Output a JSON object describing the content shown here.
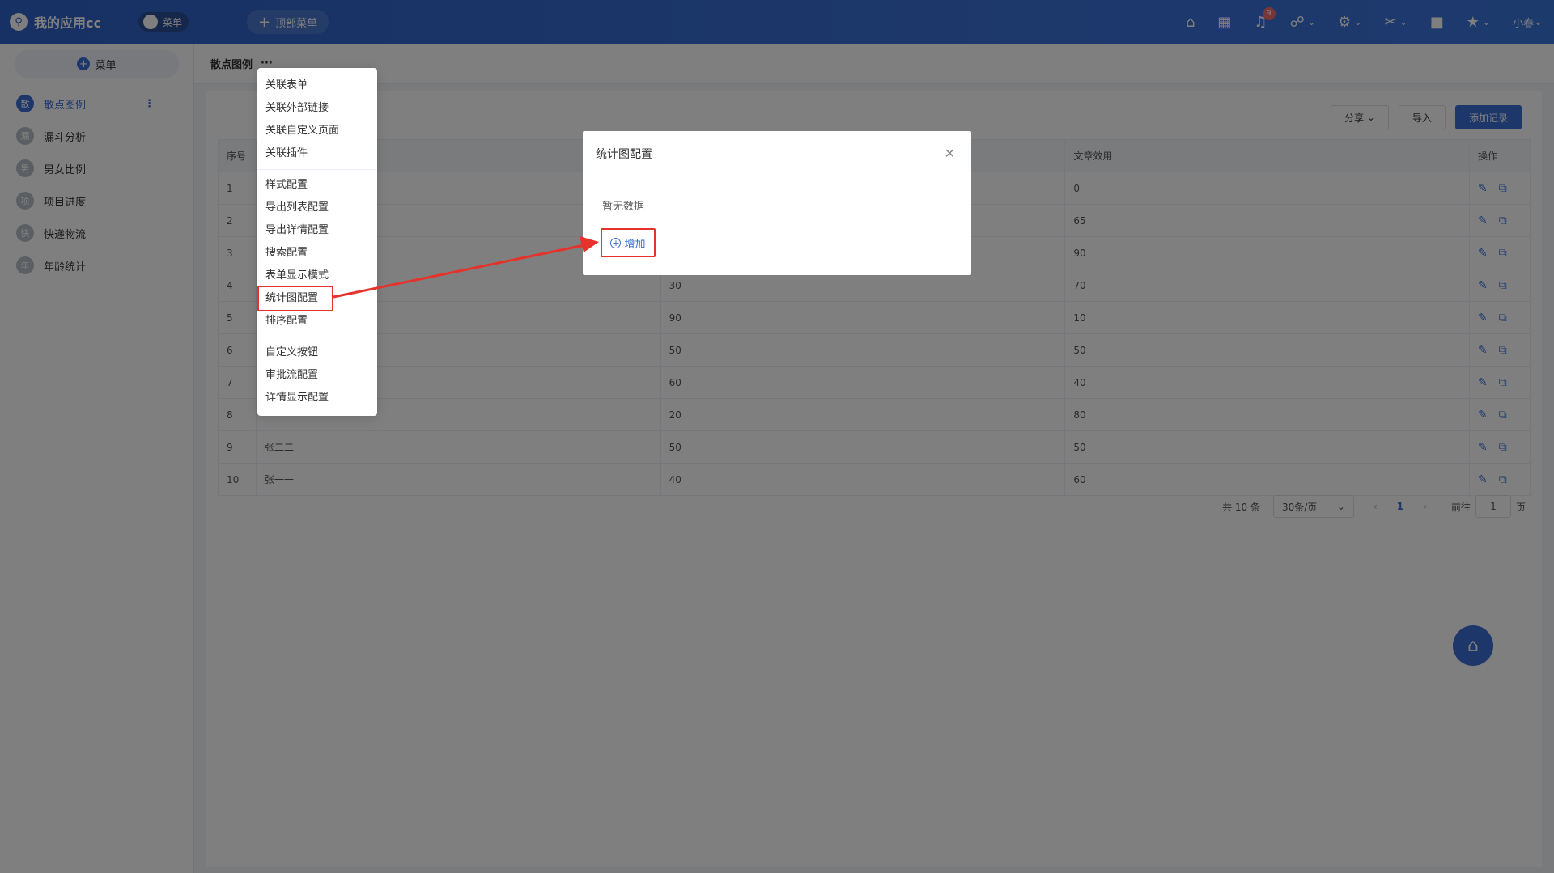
{
  "topbar": {
    "app_title": "我的应用cc",
    "menu_toggle_label": "菜单",
    "top_menu_label": "顶部菜单",
    "notification_count": "9",
    "user_name": "小春"
  },
  "sidebar": {
    "menu_button_label": "菜单",
    "items": [
      {
        "avatar": "散",
        "label": "散点图例"
      },
      {
        "avatar": "漏",
        "label": "漏斗分析"
      },
      {
        "avatar": "男",
        "label": "男女比例"
      },
      {
        "avatar": "项",
        "label": "项目进度"
      },
      {
        "avatar": "快",
        "label": "快递物流"
      },
      {
        "avatar": "年",
        "label": "年龄统计"
      }
    ]
  },
  "breadcrumb": {
    "title": "散点图例",
    "more": "···"
  },
  "toolbar": {
    "share_label": "分享",
    "import_label": "导入",
    "add_label": "添加记录"
  },
  "table": {
    "headers": [
      "序号",
      "",
      "",
      "文章效用",
      "操作"
    ],
    "rows": [
      {
        "idx": "1",
        "name": "",
        "a": "",
        "b": "0"
      },
      {
        "idx": "2",
        "name": "",
        "a": "",
        "b": "65"
      },
      {
        "idx": "3",
        "name": "",
        "a": "",
        "b": "90"
      },
      {
        "idx": "4",
        "name": "",
        "a": "30",
        "b": "70"
      },
      {
        "idx": "5",
        "name": "",
        "a": "90",
        "b": "10"
      },
      {
        "idx": "6",
        "name": "",
        "a": "50",
        "b": "50"
      },
      {
        "idx": "7",
        "name": "",
        "a": "60",
        "b": "40"
      },
      {
        "idx": "8",
        "name": "",
        "a": "20",
        "b": "80"
      },
      {
        "idx": "9",
        "name": "张二二",
        "a": "50",
        "b": "50"
      },
      {
        "idx": "10",
        "name": "张一一",
        "a": "40",
        "b": "60"
      }
    ]
  },
  "pager": {
    "total": "共 10 条",
    "page_size": "30条/页",
    "current": "1",
    "goto_label": "前往",
    "goto_value": "1",
    "page_suffix": "页"
  },
  "dropdown": {
    "group1": [
      "关联表单",
      "关联外部链接",
      "关联自定义页面",
      "关联插件"
    ],
    "group2": [
      "样式配置",
      "导出列表配置",
      "导出详情配置",
      "搜索配置",
      "表单显示模式",
      "统计图配置",
      "排序配置"
    ],
    "group3": [
      "自定义按钮",
      "审批流配置",
      "详情显示配置"
    ]
  },
  "modal": {
    "title": "统计图配置",
    "empty_text": "暂无数据",
    "add_label": "增加"
  },
  "colors": {
    "primary": "#3a6fd6",
    "highlight": "#e5322b"
  }
}
